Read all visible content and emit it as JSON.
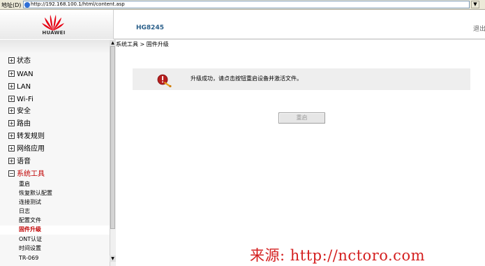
{
  "browser": {
    "address_label": "地址(D)",
    "url": "http://192.168.100.1/html/content.asp"
  },
  "header": {
    "logo_text": "HUAWEI",
    "model": "HG8245",
    "logout_label": "退出"
  },
  "sidebar": {
    "menu": [
      {
        "label": "状态",
        "expander": "+"
      },
      {
        "label": "WAN",
        "expander": "+"
      },
      {
        "label": "LAN",
        "expander": "+"
      },
      {
        "label": "Wi-Fi",
        "expander": "+"
      },
      {
        "label": "安全",
        "expander": "+"
      },
      {
        "label": "路由",
        "expander": "+"
      },
      {
        "label": "转发规则",
        "expander": "+"
      },
      {
        "label": "网络应用",
        "expander": "+"
      },
      {
        "label": "语音",
        "expander": "+"
      },
      {
        "label": "系统工具",
        "expander": "−"
      }
    ],
    "sub_items": [
      {
        "label": "重启"
      },
      {
        "label": "恢复默认配置"
      },
      {
        "label": "连接测试"
      },
      {
        "label": "日志"
      },
      {
        "label": "配置文件"
      },
      {
        "label": "固件升级"
      },
      {
        "label": "ONT认证"
      },
      {
        "label": "时间设置"
      },
      {
        "label": "TR-069"
      }
    ]
  },
  "main": {
    "breadcrumb": "系统工具 > 固件升级",
    "message": "升级成功，请点击按钮重启设备并激活文件。",
    "restart_button": "重启"
  },
  "watermark": "来源: http://nctoro.com",
  "colors": {
    "accent_red": "#c00000",
    "model_blue": "#2a5f8a",
    "logo_red": "#e60012"
  }
}
